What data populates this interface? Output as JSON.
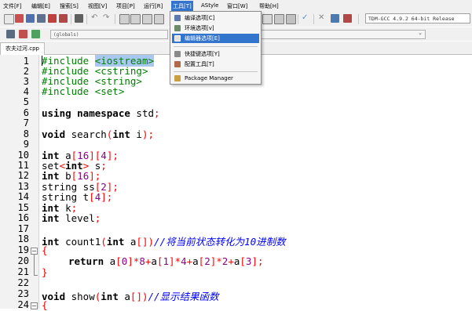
{
  "menubar": {
    "items": [
      "文件[F]",
      "编辑[E]",
      "搜索[S]",
      "视图[V]",
      "项目[P]",
      "运行[R]",
      "工具[T]",
      "AStyle",
      "窗口[W]",
      "帮助[H]"
    ],
    "active_index": 6
  },
  "toolbar": {
    "compiler": "TDM-GCC 4.9.2 64-bit Release",
    "globals": "(globals)"
  },
  "tools_menu": {
    "items": [
      {
        "label": "编译选项[C]",
        "icon": "compile-options-icon",
        "selected": false
      },
      {
        "label": "环境选项[v]",
        "icon": "environment-options-icon",
        "selected": false
      },
      {
        "label": "编辑器选项[E]",
        "icon": "editor-options-icon",
        "selected": true
      },
      {
        "label": "快捷键选项[Y]",
        "icon": "shortcut-options-icon",
        "selected": false
      },
      {
        "label": "配置工具[T]",
        "icon": "configure-tools-icon",
        "selected": false
      },
      {
        "label": "Package Manager",
        "icon": "package-manager-icon",
        "selected": false
      }
    ]
  },
  "editor": {
    "tab_label": "农夫过河.cpp",
    "line_numbers": [
      "1",
      "2",
      "3",
      "4",
      "5",
      "6",
      "7",
      "8",
      "9",
      "10",
      "11",
      "12",
      "13",
      "14",
      "15",
      "16",
      "17",
      "18",
      "19",
      "20",
      "21",
      "22",
      "23",
      "24"
    ],
    "code": {
      "l1_a": "#include ",
      "l1_b": "<iostream>",
      "l2_a": "#include ",
      "l2_b": "<cstring>",
      "l3_a": "#include ",
      "l3_b": "<string>",
      "l4_a": "#include ",
      "l4_b": "<set>",
      "l6_a": "using namespace",
      "l6_b": " std",
      "l6_c": ";",
      "l8_a": "void",
      "l8_b": " search",
      "l8_c": "(",
      "l8_d": "int",
      "l8_e": " i",
      "l8_f": ");",
      "l10_a": "int",
      "l10_b": " a",
      "l10_c": "[",
      "l10_d": "16",
      "l10_e": "][",
      "l10_f": "4",
      "l10_g": "];",
      "l11_a": "set",
      "l11_b": "<",
      "l11_c": "int",
      "l11_d": ">",
      "l11_e": " s",
      "l11_f": ";",
      "l12_a": "int",
      "l12_b": " b",
      "l12_c": "[",
      "l12_d": "16",
      "l12_e": "];",
      "l13_a": "string ss",
      "l13_b": "[",
      "l13_c": "2",
      "l13_d": "];",
      "l14_a": "string t",
      "l14_b": "[",
      "l14_c": "4",
      "l14_d": "];",
      "l15_a": "int",
      "l15_b": " k",
      "l15_c": ";",
      "l16_a": "int",
      "l16_b": " level",
      "l16_c": ";",
      "l18_a": "int",
      "l18_b": " count1",
      "l18_c": "(",
      "l18_d": "int",
      "l18_e": " a",
      "l18_f": "[])",
      "l18_g": "//将当前状态转化为10进制数",
      "l19_a": "{",
      "l20_a": "return",
      "l20_b": " a",
      "l20_c": "[",
      "l20_d": "0",
      "l20_e": "]*",
      "l20_f": "8",
      "l20_g": "+",
      "l20_h": "a",
      "l20_i": "[",
      "l20_j": "1",
      "l20_k": "]*",
      "l20_l": "4",
      "l20_m": "+",
      "l20_n": "a",
      "l20_o": "[",
      "l20_p": "2",
      "l20_q": "]*",
      "l20_r": "2",
      "l20_s": "+",
      "l20_t": "a",
      "l20_u": "[",
      "l20_v": "3",
      "l20_w": "];",
      "l21_a": "}",
      "l23_a": "void",
      "l23_b": " show",
      "l23_c": "(",
      "l23_d": "int",
      "l23_e": " a",
      "l23_f": "[])",
      "l23_g": "//显示结果函数",
      "l24_a": "{"
    }
  },
  "colors": {
    "preprocessor": "#008000",
    "punctuation": "#ff0000",
    "number": "#8b008b",
    "comment": "#0000ff",
    "menu_highlight": "#3374cc",
    "bracket_highlight": "#a8c8f0"
  }
}
